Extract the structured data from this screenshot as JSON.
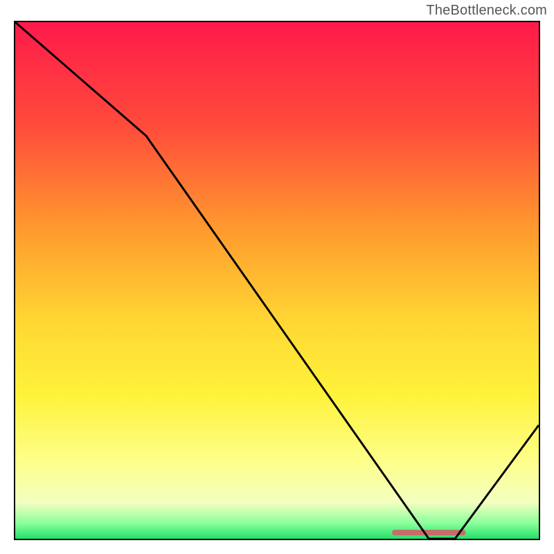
{
  "watermark": "TheBottleneck.com",
  "chart_data": {
    "type": "line",
    "title": "",
    "xlabel": "",
    "ylabel": "",
    "xlim": [
      0,
      100
    ],
    "ylim": [
      0,
      100
    ],
    "x": [
      0,
      25,
      79,
      84,
      100
    ],
    "values": [
      100,
      78,
      0,
      0,
      22
    ],
    "optimal_band": {
      "x0": 72,
      "x1": 86,
      "y": 1.2
    },
    "gradient_stops": [
      {
        "offset": 0.0,
        "color": "#ff1a4b"
      },
      {
        "offset": 0.2,
        "color": "#ff4b3b"
      },
      {
        "offset": 0.4,
        "color": "#ff9a2e"
      },
      {
        "offset": 0.58,
        "color": "#ffd733"
      },
      {
        "offset": 0.72,
        "color": "#fff23a"
      },
      {
        "offset": 0.85,
        "color": "#fdff8a"
      },
      {
        "offset": 0.93,
        "color": "#f3ffc0"
      },
      {
        "offset": 0.97,
        "color": "#8aff9a"
      },
      {
        "offset": 1.0,
        "color": "#22e06a"
      }
    ]
  }
}
